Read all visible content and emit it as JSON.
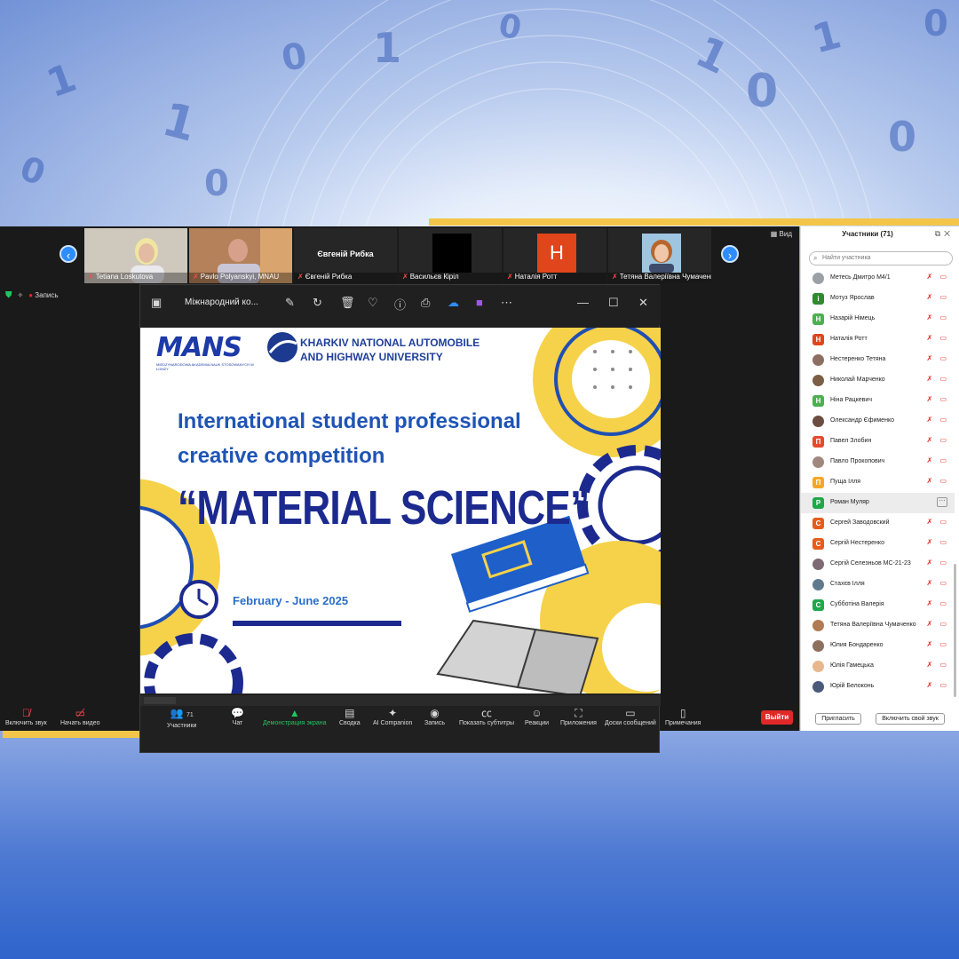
{
  "strip": {
    "participants": [
      {
        "name": "Tetiana Loskutova",
        "kind": "video"
      },
      {
        "name": "Pavlo Polyanskyi, MNAU",
        "kind": "video"
      },
      {
        "name": "Євгеній Рибка",
        "center": "Євгеній Рибка",
        "kind": "name"
      },
      {
        "name": "Васильєв Кіріл",
        "kind": "black"
      },
      {
        "name": "Наталія Ротт",
        "kind": "letter",
        "letter": "Н",
        "color": "#e0451b"
      },
      {
        "name": "Тетяна Валеріївна Чумаченко",
        "kind": "photo"
      }
    ],
    "view_label": "Вид"
  },
  "recording": {
    "label": "Запись"
  },
  "shared_window": {
    "title": "Міжнародний ко..."
  },
  "slide": {
    "mans_logo": "MANS",
    "mans_sub": "MIEDZYNARODOWA AKADEMIA NAUK STOSOWANYCH W ŁOMŻY",
    "university_line1": "KHARKIV NATIONAL AUTOMOBILE",
    "university_line2": "AND HIGHWAY UNIVERSITY",
    "heading_line1": "International student professional",
    "heading_line2": "creative competition",
    "big_title": "“MATERIAL SCIENCE”",
    "dates": "February - June 2025"
  },
  "toolbar": {
    "mute_label": "Включить звук",
    "video_label": "Начать видео",
    "participants_label": "Участники",
    "participants_count": "71",
    "chat_label": "Чат",
    "share_label": "Демонстрация экрана",
    "summary_label": "Сводка",
    "ai_label": "AI Companion",
    "record_label": "Запись",
    "captions_label": "Показать субтитры",
    "reactions_label": "Реакции",
    "apps_label": "Приложения",
    "whiteboards_label": "Доски сообщений",
    "notes_label": "Примечания",
    "exit_label": "Выйти"
  },
  "panel": {
    "title": "Участники (71)",
    "search_placeholder": "Найти участника",
    "invite_label": "Пригласить",
    "unmute_label": "Включить свой звук",
    "list": [
      {
        "name": "Метесь Дмитро М4/1",
        "av": "",
        "color": "#9aa0a6",
        "photo": true
      },
      {
        "name": "Мотуз Ярослав",
        "av": "і",
        "color": "#2e8b2e"
      },
      {
        "name": "Назарій Німець",
        "av": "Н",
        "color": "#4caf50"
      },
      {
        "name": "Наталія Ротт",
        "av": "Н",
        "color": "#e0451b"
      },
      {
        "name": "Нестеренко Тетяна",
        "av": "",
        "color": "#8d6e63",
        "photo": true
      },
      {
        "name": "Николай Марченко",
        "av": "",
        "color": "#7b5e45",
        "photo": true
      },
      {
        "name": "Ніна Рацкевич",
        "av": "Н",
        "color": "#4caf50"
      },
      {
        "name": "Олександр Єфименко",
        "av": "",
        "color": "#6d4c41",
        "photo": true
      },
      {
        "name": "Павел Злобин",
        "av": "П",
        "color": "#e64a2e"
      },
      {
        "name": "Павло Прокопович",
        "av": "",
        "color": "#a1887f",
        "photo": true
      },
      {
        "name": "Пуща Ілля",
        "av": "П",
        "color": "#f5a623"
      },
      {
        "name": "Роман Муляр",
        "av": "Р",
        "color": "#1ea84a",
        "selected": true
      },
      {
        "name": "Сергей Заводовский",
        "av": "С",
        "color": "#e65c1b"
      },
      {
        "name": "Сергій Нестеренко",
        "av": "С",
        "color": "#e65c1b"
      },
      {
        "name": "Сергій Селезньов МС-21-23",
        "av": "",
        "color": "#7e6a72",
        "photo": true
      },
      {
        "name": "Стахєв Ілля",
        "av": "",
        "color": "#5f7a8c",
        "photo": true
      },
      {
        "name": "Субботіна Валерія",
        "av": "С",
        "color": "#1ea84a"
      },
      {
        "name": "Тетяна Валеріївна Чумаченко",
        "av": "",
        "color": "#b07a52",
        "photo": true
      },
      {
        "name": "Юлия Бондаренко",
        "av": "",
        "color": "#8e6f5e",
        "photo": true
      },
      {
        "name": "Юлія Гамецька",
        "av": "",
        "color": "#e8b78e",
        "photo": true
      },
      {
        "name": "Юрій Белоконь",
        "av": "",
        "color": "#4a5a7a",
        "photo": true
      }
    ]
  }
}
